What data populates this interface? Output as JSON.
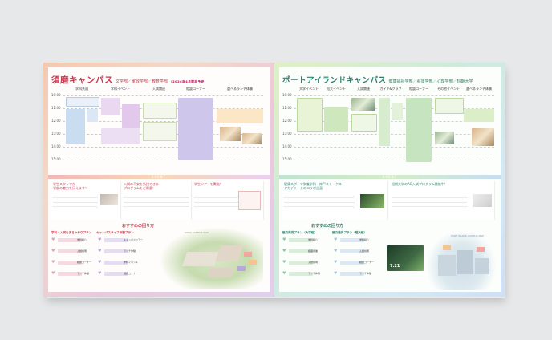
{
  "left_page": {
    "title": "須磨キャンパス",
    "subtitle": "文学部／家政学部／教育学部",
    "note": "（2026年4月開設予定）",
    "columns": [
      "学科共通",
      "学科イベント",
      "入試関連",
      "相談コーナー",
      "選べるランチ体験"
    ],
    "times": [
      "10:00",
      "11:00",
      "12:00",
      "13:00",
      "14:00",
      "15:00"
    ],
    "event_label": "EVENT",
    "cards": [
      {
        "heading": "学生スタッフが\n学部の魅力を伝えます！"
      },
      {
        "heading": "入試の不安を払拭できる\nプログラムをご用意！"
      },
      {
        "heading": "学生ツアーを実施！"
      }
    ],
    "recommend_title": "おすすめの回り方",
    "plans": [
      {
        "name": "学科・入試をまるわかりプラン",
        "steps": [
          "学科紹介",
          "入試説明",
          "相談コーナー",
          "ランチ体験"
        ]
      },
      {
        "name": "キャンパスライフ体験プラン",
        "steps": [
          "キャンパスツアー",
          "ランチ体験",
          "学科イベント",
          "相談コーナー"
        ]
      }
    ],
    "map_label": "SUMA CAMPUS MAP"
  },
  "right_page": {
    "title": "ポートアイランドキャンパス",
    "subtitle": "健康福祉学部／看護学部／心理学部／短期大学",
    "columns": [
      "大学イベント",
      "短大イベント",
      "入試関連",
      "ガイド&クラブ",
      "相談コーナー",
      "その他イベント",
      "選べるランチ体験"
    ],
    "times": [
      "10:00",
      "11:00",
      "12:00",
      "13:00",
      "14:00",
      "15:00"
    ],
    "event_label": "EVENT",
    "cards": [
      {
        "heading": "健康スポーツ栄養学科・神戸ストークス\nアカデミーとのコラボ企画"
      },
      {
        "heading": "短期大学のAO入試プログラム実施中！"
      }
    ],
    "recommend_title": "おすすめの回り方",
    "plans": [
      {
        "name": "魅力発見プラン（大学編）",
        "steps": [
          "学科紹介",
          "模擬授業",
          "入試説明",
          "ランチ体験"
        ]
      },
      {
        "name": "魅力発見プラン（短大編）",
        "steps": [
          "学科紹介",
          "入試説明",
          "相談コーナー",
          "ランチ体験"
        ]
      }
    ],
    "promo_date": "7.21",
    "map_label": "PORT ISLAND CAMPUS MAP"
  }
}
